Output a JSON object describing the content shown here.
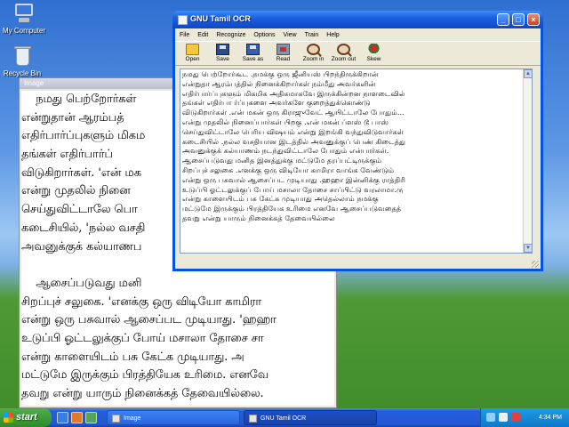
{
  "desktop": {
    "icons": [
      {
        "label": "My Computer"
      },
      {
        "label": "Recycle Bin"
      }
    ]
  },
  "image_window": {
    "title": "Image",
    "lines": [
      "    நமது பெற்றோர்கள்",
      "என்றுதான் ஆரம்பத்",
      "எதிர்பார்ப்புகளும் மிகம",
      "தங்கள் எதிர்பார்ப்",
      "விடுகிறார்கள். 'என் மக",
      "என்று முதலில் நினை",
      "செய்துவிட்டாலே பொ",
      "கடைசியில், 'நல்ல வசதி",
      "அவனுக்குக் கல்யாணப",
      "",
      "    ஆசைப்படுவது மனி",
      "சிறப்புச் சலுகை. 'எனக்கு ஒரு விடியோ காமிரா",
      "என்று ஒரு பசுவால் ஆசைப்பட முடியாது. 'ஹஹா",
      "உடுப்பி ஓட்டலுக்குப் போய் மசாலா தோசை சா",
      "என்று காளையிடம் பசு கேட்க முடியாது. அ",
      "மட்டுமே இருக்கும் பிரத்தியேக உரிமை. எனவே",
      "தவறு என்று யாரும் நினைக்கத் தேவையில்லை."
    ]
  },
  "ocr_window": {
    "title": "GNU Tamil OCR",
    "menu": [
      "File",
      "Edit",
      "Recognize",
      "Options",
      "View",
      "Train",
      "Help"
    ],
    "toolbar": [
      {
        "label": "Open",
        "icon": "folder-open-icon"
      },
      {
        "label": "Save",
        "icon": "floppy-disk-icon"
      },
      {
        "label": "Save as",
        "icon": "floppy-disk-save-as-icon"
      },
      {
        "label": "Read",
        "icon": "scanner-read-icon"
      },
      {
        "label": "Zoom in",
        "icon": "zoom-in-icon"
      },
      {
        "label": "Zoom out",
        "icon": "zoom-out-icon"
      },
      {
        "label": "Skew",
        "icon": "skew-icon"
      }
    ],
    "text_lines": [
      "நமது பெற்றோர்கூட .நமக்கு ஒரு ஜீனியஸ் பிறந்திருக்கிறான்",
      "என்றுதா ஆரம்பத்தில் நினைக்கிறார்கள் நம்மீது அவர்களின்",
      "எதிர்பார்ப்புகளும் மிகமிக அதிகமாகவே இருக்கின்றன நாளடைவில்",
      "தங்கள் எதிர்பா ர்ப்புகளை அவர்களே குறைத்துக்கொண்டு",
      "விடுகிறார்கள் .என் மகன் ஒரு கிராஜுவேட் ஆயிட்டாலே போதும்...",
      "என்று முதலில் நினைப்பார்கள் பிறகு .என் மகன் ப்ளஸ் டூ பாஸ்",
      "செய்துவிட்டாலே பெரிய விஷயம் என்று இறங்கி வந்துவிடுவார்கள்",
      "கடைசியில் .நல்ல வசதியான இடத்தில் அவனுக்குப் பெண் கிடைத்து",
      "அவனுக்குக் கல்யாணம் நடந்துவிட்டாலே போதும் என்பார்கள்.",
      "ஆசைப்படுவது மனித இனத்துக்கு மட்டுமே தரப்பட்டிருக்கும்",
      "சிறப்புச் சலுகை .எனக்கு ஒரு விடியோ காமிரா வாங்க வேண்டும்",
      "என்று ஒரு பசுவால் ஆசைப்பட முடியாது .ஹஹா இன்னிக்கு ராத்திரி",
      "உடுப்பி ஓட்டலுக்குப் போய் மசாலா தோசை சாப்பிட்டு வரலாமா.ரு",
      "என்று காளையிடம் பசு கேட்க முடியாது அதெல்லாம் நமக்கு",
      "மட்டுமே இருக்கும் பிரத்தியேக உரிமை எனவே ஆசைப்படுவதைத்",
      "தவறு என்று யாரும் நினைக்கத் தேவையில்லை"
    ]
  },
  "taskbar": {
    "start_label": "start",
    "tasks": [
      {
        "label": "Image"
      },
      {
        "label": "GNU Tamil OCR"
      }
    ],
    "clock": "4:34 PM"
  }
}
